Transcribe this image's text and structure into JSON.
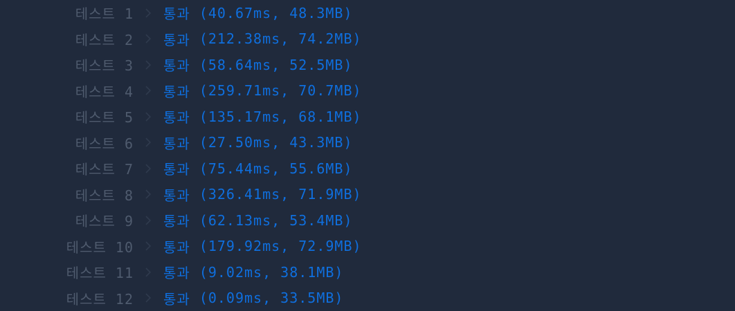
{
  "test_results": {
    "chevron_icon": "chevron-right-icon",
    "label_color": "#4f5b6e",
    "status_color": "#0f6fde",
    "rows": [
      {
        "label": "테스트 1",
        "status": "통과",
        "detail": "(40.67ms, 48.3MB)"
      },
      {
        "label": "테스트 2",
        "status": "통과",
        "detail": "(212.38ms, 74.2MB)"
      },
      {
        "label": "테스트 3",
        "status": "통과",
        "detail": "(58.64ms, 52.5MB)"
      },
      {
        "label": "테스트 4",
        "status": "통과",
        "detail": "(259.71ms, 70.7MB)"
      },
      {
        "label": "테스트 5",
        "status": "통과",
        "detail": "(135.17ms, 68.1MB)"
      },
      {
        "label": "테스트 6",
        "status": "통과",
        "detail": "(27.50ms, 43.3MB)"
      },
      {
        "label": "테스트 7",
        "status": "통과",
        "detail": "(75.44ms, 55.6MB)"
      },
      {
        "label": "테스트 8",
        "status": "통과",
        "detail": "(326.41ms, 71.9MB)"
      },
      {
        "label": "테스트 9",
        "status": "통과",
        "detail": "(62.13ms, 53.4MB)"
      },
      {
        "label": "테스트 10",
        "status": "통과",
        "detail": "(179.92ms, 72.9MB)"
      },
      {
        "label": "테스트 11",
        "status": "통과",
        "detail": "(9.02ms, 38.1MB)"
      },
      {
        "label": "테스트 12",
        "status": "통과",
        "detail": "(0.09ms, 33.5MB)"
      }
    ]
  }
}
